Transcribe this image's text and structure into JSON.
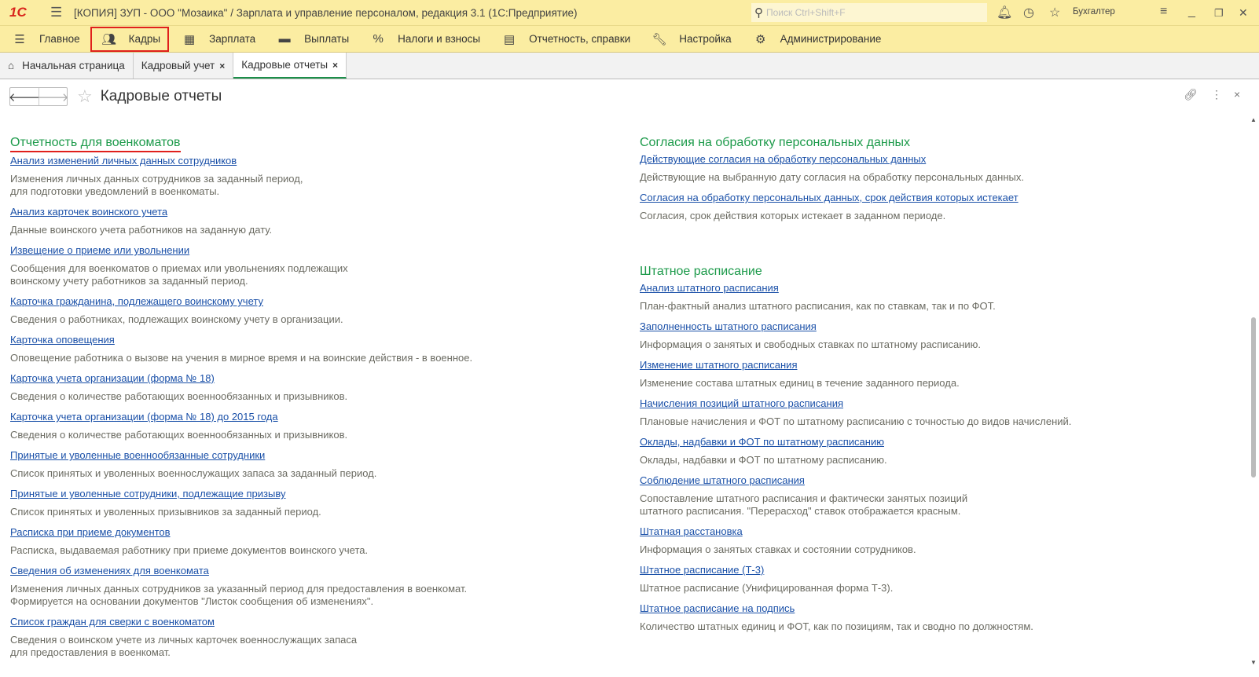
{
  "titlebar": {
    "logo": "1С",
    "title": "[КОПИЯ] ЗУП - ООО \"Мозаика\" / Зарплата и управление персоналом, редакция 3.1  (1С:Предприятие)",
    "search_placeholder": "Поиск Ctrl+Shift+F",
    "user": "Бухгалтер"
  },
  "menu": [
    {
      "label": "Главное",
      "icon": "menu-icon"
    },
    {
      "label": "Кадры",
      "icon": "people-icon"
    },
    {
      "label": "Зарплата",
      "icon": "calculator-icon"
    },
    {
      "label": "Выплаты",
      "icon": "wallet-icon"
    },
    {
      "label": "Налоги и взносы",
      "icon": "percent-icon"
    },
    {
      "label": "Отчетность, справки",
      "icon": "reports-icon"
    },
    {
      "label": "Настройка",
      "icon": "wrench-icon"
    },
    {
      "label": "Администрирование",
      "icon": "gear-icon"
    }
  ],
  "tabs": [
    {
      "label": "Начальная страница"
    },
    {
      "label": "Кадровый учет"
    },
    {
      "label": "Кадровые отчеты"
    }
  ],
  "page": {
    "title": "Кадровые отчеты"
  },
  "left": {
    "title": "Отчетность для военкоматов",
    "items": [
      {
        "link": "Анализ изменений личных данных сотрудников",
        "desc": "Изменения личных данных сотрудников за заданный период,\nдля подготовки уведомлений в военкоматы."
      },
      {
        "link": "Анализ карточек воинского учета",
        "desc": "Данные воинского учета работников на заданную дату."
      },
      {
        "link": "Извещение о приеме или увольнении",
        "desc": "Сообщения для военкоматов о приемах или увольнениях подлежащих\nвоинскому учету работников за заданный период."
      },
      {
        "link": "Карточка гражданина, подлежащего воинскому учету",
        "desc": "Сведения о работниках, подлежащих воинскому учету в организации."
      },
      {
        "link": "Карточка оповещения",
        "desc": "Оповещение работника о вызове на учения в мирное время и на воинские действия - в военное."
      },
      {
        "link": "Карточка учета организации (форма № 18)",
        "desc": "Сведения о количестве работающих военнообязанных и призывников."
      },
      {
        "link": "Карточка учета организации (форма № 18) до 2015 года",
        "desc": "Сведения о количестве работающих военнообязанных и призывников."
      },
      {
        "link": "Принятые и уволенные военнообязанные сотрудники",
        "desc": "Список принятых и уволенных военнослужащих запаса за заданный период."
      },
      {
        "link": "Принятые и уволенные сотрудники, подлежащие призыву",
        "desc": "Список принятых и уволенных призывников за заданный период."
      },
      {
        "link": "Расписка при приеме документов",
        "desc": "Расписка, выдаваемая работнику при приеме документов воинского учета."
      },
      {
        "link": "Сведения об изменениях для военкомата",
        "desc": "Изменения личных данных сотрудников за указанный период для предоставления в военкомат.\nФормируется на основании документов \"Листок сообщения об изменениях\"."
      },
      {
        "link": "Список граждан для сверки с военкоматом",
        "desc": "Сведения о воинском учете из личных карточек военнослужащих запаса\nдля предоставления в военкомат."
      }
    ]
  },
  "right1": {
    "title": "Согласия на обработку персональных данных",
    "items": [
      {
        "link": "Действующие согласия на обработку персональных данных",
        "desc": "Действующие на выбранную дату согласия на обработку персональных данных."
      },
      {
        "link": "Согласия на обработку персональных данных, срок действия которых истекает",
        "desc": "Согласия, срок действия которых истекает в заданном периоде."
      }
    ]
  },
  "right2": {
    "title": "Штатное расписание",
    "items": [
      {
        "link": "Анализ штатного расписания",
        "desc": "План-фактный анализ штатного расписания, как по ставкам, так и по ФОТ."
      },
      {
        "link": "Заполненность штатного расписания",
        "desc": "Информация о занятых и свободных ставках по штатному расписанию."
      },
      {
        "link": "Изменение штатного расписания",
        "desc": "Изменение состава штатных единиц в течение заданного периода."
      },
      {
        "link": "Начисления позиций штатного расписания",
        "desc": "Плановые начисления и ФОТ по штатному расписанию с точностью до видов начислений."
      },
      {
        "link": "Оклады, надбавки и ФОТ по штатному расписанию",
        "desc": "Оклады, надбавки и ФОТ по штатному расписанию."
      },
      {
        "link": "Соблюдение штатного расписания",
        "desc": "Сопоставление штатного расписания и фактически занятых позиций\nштатного расписания. \"Перерасход\" ставок отображается красным."
      },
      {
        "link": "Штатная расстановка",
        "desc": "Информация о занятых ставках и состоянии сотрудников."
      },
      {
        "link": "Штатное расписание (Т-3)",
        "desc": "Штатное расписание (Унифицированная форма Т-3)."
      },
      {
        "link": "Штатное расписание на подпись",
        "desc": "Количество штатных единиц и ФОТ, как по позициям, так и сводно по должностям."
      }
    ]
  }
}
